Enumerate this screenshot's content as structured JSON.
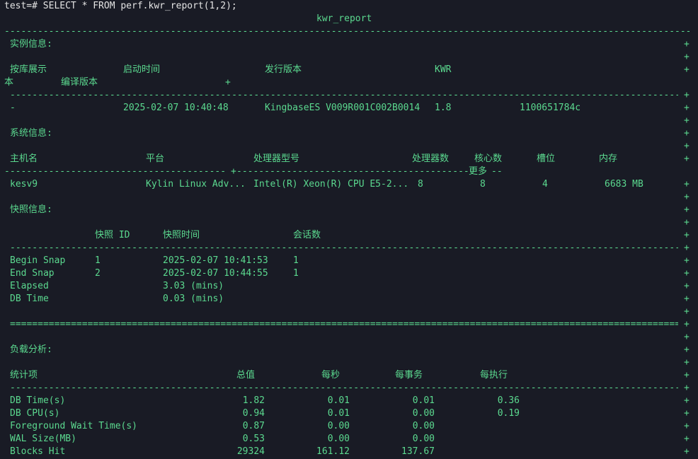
{
  "command": "test=# SELECT * FROM perf.kwr_report(1,2);",
  "column_header": "kwr_report",
  "plus": "+",
  "dash_text": "----------------------------------------------------------------------------------------------------------------------------------------------------",
  "eq_text": "====================================================================================================================================================",
  "instance": {
    "section_title": "实例信息:",
    "headers": [
      "按库展示",
      "启动时间",
      "发行版本",
      "KWR"
    ],
    "header_wrap": [
      "本",
      "编译版本"
    ],
    "row": [
      "-",
      "2025-02-07 10:40:48",
      "KingbaseES V009R001C002B0014",
      "1.8",
      "1100651784c"
    ]
  },
  "system": {
    "section_title": "系统信息:",
    "headers": [
      "主机名",
      "平台",
      "处理器型号",
      "处理器数",
      "核心数",
      "槽位",
      "内存"
    ],
    "more_label": "更多",
    "row": [
      "kesv9",
      "Kylin Linux Adv...",
      "Intel(R) Xeon(R) CPU E5-2...",
      "8",
      "8",
      "4",
      "6683 MB"
    ]
  },
  "snapshot": {
    "section_title": "快照信息:",
    "headers": [
      "快照 ID",
      "快照时间",
      "会话数"
    ],
    "rows": [
      {
        "label": "Begin Snap",
        "id": "1",
        "time": "2025-02-07 10:41:53",
        "sessions": "1"
      },
      {
        "label": "End Snap",
        "id": "2",
        "time": "2025-02-07 10:44:55",
        "sessions": "1"
      }
    ],
    "elapsed_label": "Elapsed",
    "elapsed_value": "3.03 (mins)",
    "dbtime_label": "DB Time",
    "dbtime_value": "0.03 (mins)"
  },
  "load": {
    "section_title": "负载分析:",
    "headers": [
      "统计项",
      "总值",
      "每秒",
      "每事务",
      "每执行"
    ],
    "rows": [
      {
        "name": "DB Time(s)",
        "total": "1.82",
        "per_sec": "0.01",
        "per_txn": "0.01",
        "per_exec": "0.36"
      },
      {
        "name": "DB CPU(s)",
        "total": "0.94",
        "per_sec": "0.01",
        "per_txn": "0.00",
        "per_exec": "0.19"
      },
      {
        "name": "Foreground Wait Time(s)",
        "total": "0.87",
        "per_sec": "0.00",
        "per_txn": "0.00",
        "per_exec": ""
      },
      {
        "name": "WAL Size(MB)",
        "total": "0.53",
        "per_sec": "0.00",
        "per_txn": "0.00",
        "per_exec": ""
      },
      {
        "name": "Blocks Hit",
        "total": "29324",
        "per_sec": "161.12",
        "per_txn": "137.67",
        "per_exec": ""
      }
    ]
  }
}
